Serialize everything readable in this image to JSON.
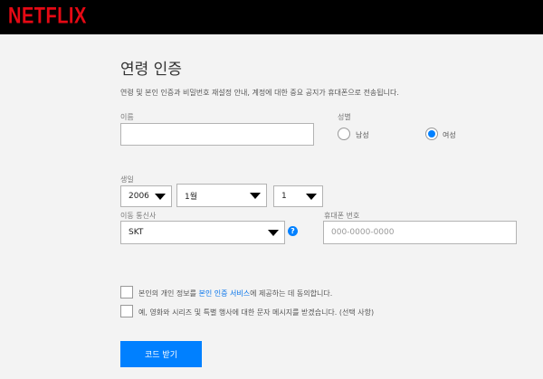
{
  "header": {
    "logo": "NETFLIX"
  },
  "page": {
    "title": "연령 인증",
    "description": "연령 및 본인 인증과 비밀번호 재설정 안내, 계정에 대한 중요 공지가 휴대폰으로 전송됩니다."
  },
  "form": {
    "name_label": "이름",
    "name_value": "",
    "gender_label": "성별",
    "gender_options": [
      "남성",
      "여성"
    ],
    "gender_selected": "여성",
    "birth_label": "생일",
    "birth_year": "2006",
    "birth_month": "1월",
    "birth_day": "1",
    "carrier_label": "이동 통신사",
    "carrier_value": "SKT",
    "help_glyph": "?",
    "phone_label": "휴대폰 번호",
    "phone_placeholder": "000-0000-0000",
    "consent_pre": "본인의 개인 정보를 ",
    "consent_link": "본인 인증 서비스",
    "consent_post": "에 제공하는 데 동의합니다.",
    "marketing_text": "예, 영화와 시리즈 및 특별 행사에 대한 문자 메시지를 받겠습니다. (선택 사항)",
    "submit_label": "코드 받기"
  },
  "colors": {
    "brand": "#e50914",
    "accent": "#0080ff"
  }
}
